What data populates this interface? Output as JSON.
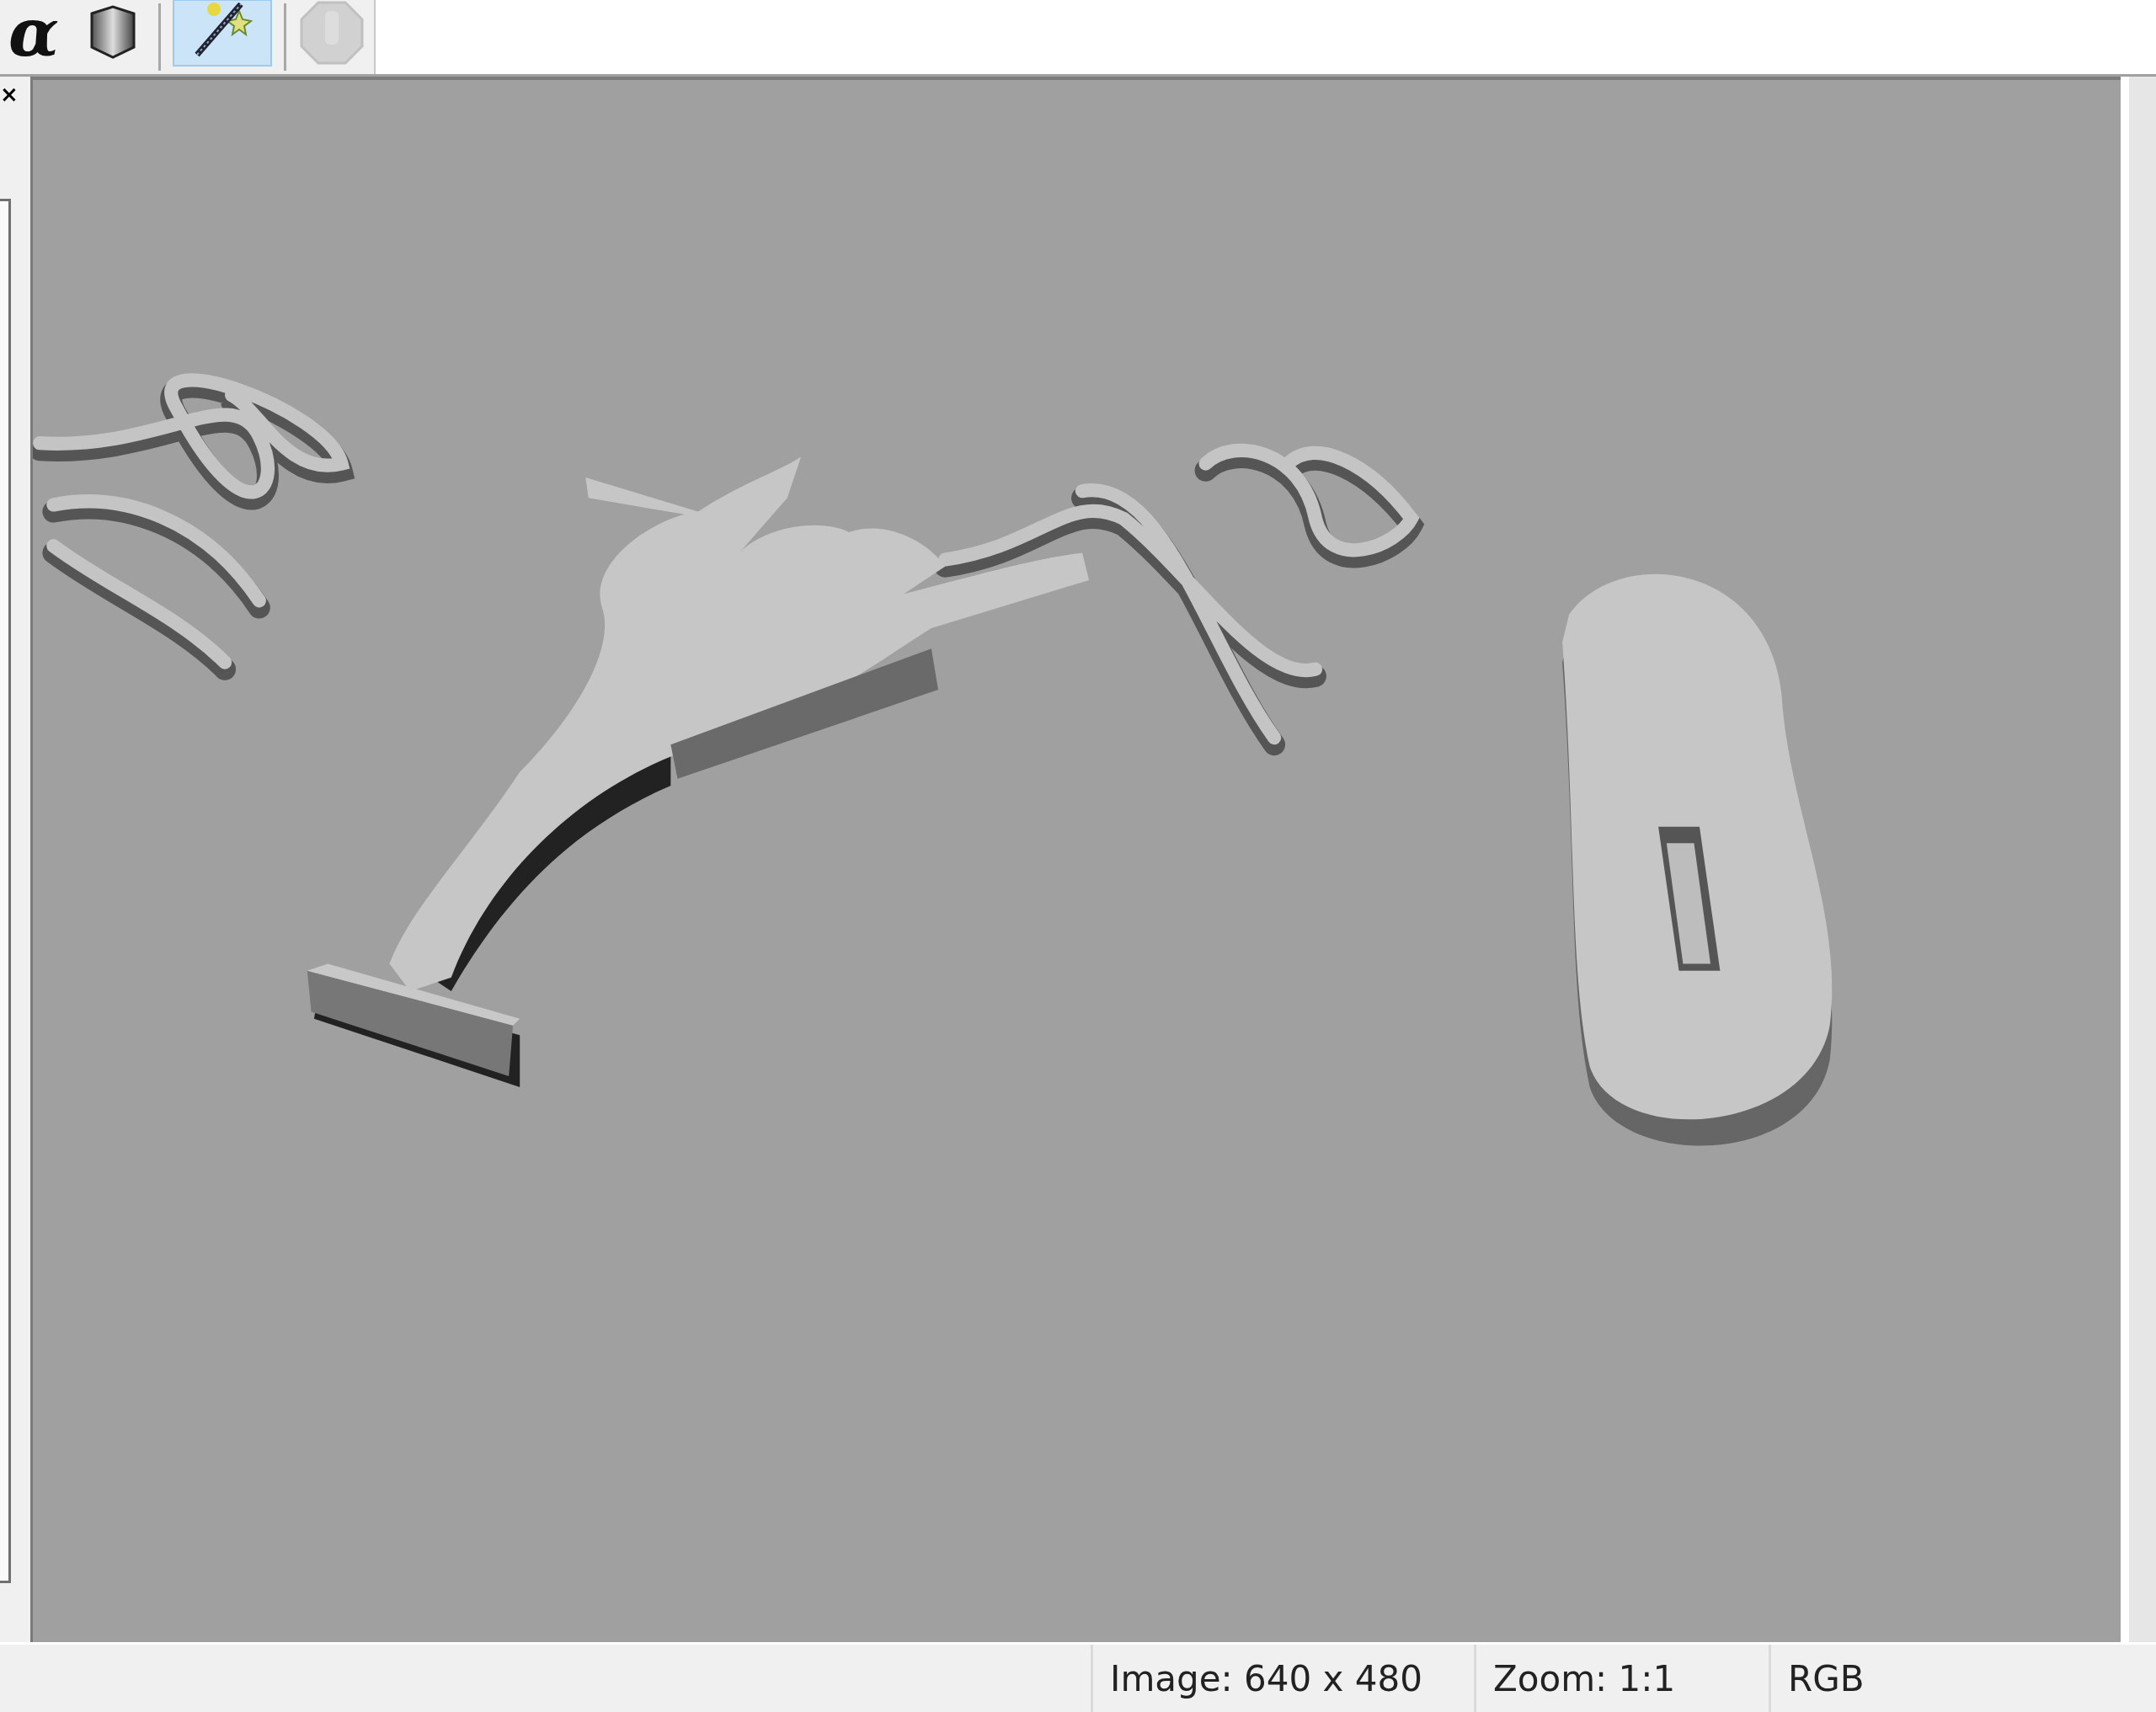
{
  "toolbar": {
    "buttons": [
      {
        "kind": "text",
        "label": "α",
        "selected": false,
        "disabled": false
      },
      {
        "kind": "cube",
        "selected": false,
        "disabled": false
      },
      {
        "kind": "wand",
        "selected": true,
        "disabled": false
      },
      {
        "kind": "stop",
        "selected": false,
        "disabled": true
      }
    ]
  },
  "side_panel": {
    "close_glyph": "×"
  },
  "status_bar": [
    "Image: 640 x 480",
    "Zoom: 1:1",
    "RGB"
  ]
}
